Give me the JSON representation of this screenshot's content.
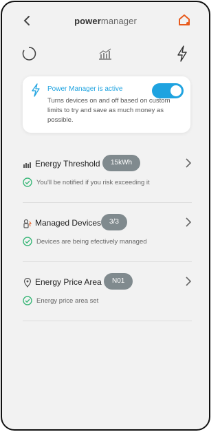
{
  "header": {
    "title_bold": "power",
    "title_light": "manager",
    "back_icon": "chevron-left-icon",
    "home_icon": "home-icon"
  },
  "tabs": [
    {
      "icon": "circle-progress-icon"
    },
    {
      "icon": "chart-icon"
    },
    {
      "icon": "bolt-icon"
    }
  ],
  "status_card": {
    "title": "Power Manager is active",
    "description": "Turns devices on and off based on custom limits to try and save as much money as possible.",
    "toggle_on": true
  },
  "rows": [
    {
      "title": "Energy Threshold",
      "badge": "15kWh",
      "status": "You'll be notified if you risk exceeding it"
    },
    {
      "title": "Managed Devices",
      "badge": "3/3",
      "status": "Devices are being efectively managed"
    },
    {
      "title": "Energy Price Area",
      "badge": "N01",
      "status": "Energy price area set"
    }
  ],
  "colors": {
    "accent": "#1fa3e0",
    "home": "#e85a1c",
    "check": "#3cb87a",
    "badge": "#808a8e"
  }
}
